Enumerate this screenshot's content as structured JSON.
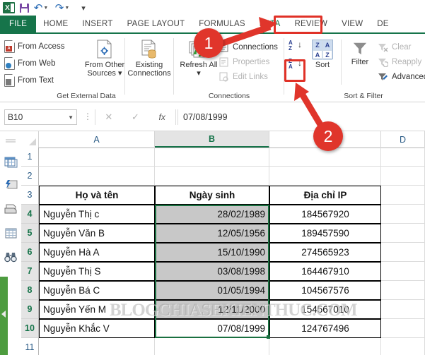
{
  "app": {
    "quick_access": [
      {
        "name": "excel-logo",
        "label": "X"
      },
      {
        "name": "save",
        "label": "Save"
      },
      {
        "name": "undo",
        "label": "Undo"
      },
      {
        "name": "redo",
        "label": "Redo"
      },
      {
        "name": "customize-quick-access-toolbar",
        "label": "Customize Quick Access Toolbar"
      }
    ]
  },
  "ribbon": {
    "tabs": [
      {
        "label": "FILE",
        "active": false,
        "style": "file"
      },
      {
        "label": "HOME",
        "active": false
      },
      {
        "label": "INSERT",
        "active": false
      },
      {
        "label": "PAGE LAYOUT",
        "active": false
      },
      {
        "label": "FORMULAS",
        "active": false
      },
      {
        "label": "DATA",
        "active": true
      },
      {
        "label": "REVIEW",
        "active": false
      },
      {
        "label": "VIEW",
        "active": false
      },
      {
        "label": "DE",
        "active": false
      }
    ],
    "groups": [
      {
        "name": "get-external-data",
        "title": "Get External Data",
        "items": [
          {
            "label": "From Access",
            "icon": "access-file-icon",
            "enabled": true
          },
          {
            "label": "From Web",
            "icon": "web-file-icon",
            "enabled": true
          },
          {
            "label": "From Text",
            "icon": "text-file-icon",
            "enabled": true
          },
          {
            "label": "From Other Sources",
            "icon": "other-sources-icon",
            "enabled": true,
            "dropdown": "▾"
          },
          {
            "label": "Existing Connections",
            "icon": "existing-connections-icon",
            "enabled": true
          }
        ]
      },
      {
        "name": "connections",
        "title": "Connections",
        "items": [
          {
            "label": "Refresh All",
            "icon": "refresh-all-icon",
            "enabled": true,
            "dropdown": "▾"
          },
          {
            "label": "Connections",
            "icon": "connections-icon",
            "enabled": true
          },
          {
            "label": "Properties",
            "icon": "properties-icon",
            "enabled": false
          },
          {
            "label": "Edit Links",
            "icon": "edit-links-icon",
            "enabled": false
          }
        ]
      },
      {
        "name": "sort-and-filter",
        "title": "Sort & Filter",
        "items": [
          {
            "label": "Sort A to Z",
            "icon": "sort-ascending-icon",
            "enabled": true,
            "top": "A",
            "bottom": "Z"
          },
          {
            "label": "Sort Z to A",
            "icon": "sort-descending-icon",
            "enabled": true,
            "top": "Z",
            "bottom": "A",
            "highlighted": true
          },
          {
            "label": "Sort",
            "icon": "sort-dialog-icon",
            "enabled": true
          },
          {
            "label": "Filter",
            "icon": "filter-funnel-icon",
            "enabled": true
          },
          {
            "label": "Clear",
            "icon": "clear-filter-icon",
            "enabled": false
          },
          {
            "label": "Reapply",
            "icon": "reapply-filter-icon",
            "enabled": false
          },
          {
            "label": "Advanced",
            "icon": "advanced-filter-icon",
            "enabled": true
          }
        ]
      }
    ]
  },
  "formula_bar": {
    "name_box": "B10",
    "cancel_icon": "✕",
    "enter_icon": "✓",
    "function_icon": "fx",
    "value": "07/08/1999"
  },
  "left_toolbar": {
    "items": [
      {
        "name": "divider",
        "icon": "divider-icon"
      },
      {
        "name": "table-tool",
        "icon": "table-icon"
      },
      {
        "name": "flash-fill-tool",
        "icon": "flash-fill-icon"
      },
      {
        "name": "print-tool",
        "icon": "printer-icon"
      },
      {
        "name": "sheet-tool",
        "icon": "sheet-grid-icon"
      },
      {
        "name": "find-tool",
        "icon": "binoculars-icon"
      }
    ]
  },
  "sheet": {
    "columns": [
      "A",
      "B",
      "C",
      "D"
    ],
    "selected_column": "B",
    "rows": [
      "1",
      "2",
      "3",
      "4",
      "5",
      "6",
      "7",
      "8",
      "9",
      "10",
      "11"
    ],
    "selected_rows": [
      "4",
      "5",
      "6",
      "7",
      "8",
      "9",
      "10"
    ],
    "headers": [
      "Họ và tên",
      "Ngày sinh",
      "Địa chỉ IP"
    ],
    "data": [
      {
        "row": "4",
        "name": "Nguyễn Thị c",
        "dob": "28/02/1989",
        "ip": "184567920",
        "shaded": true
      },
      {
        "row": "5",
        "name": "Nguyễn Văn B",
        "dob": "12/05/1956",
        "ip": "189457590",
        "shaded": true
      },
      {
        "row": "6",
        "name": "Nguyễn Hà A",
        "dob": "15/10/1990",
        "ip": "274565923",
        "shaded": true
      },
      {
        "row": "7",
        "name": "Nguyễn Thị S",
        "dob": "03/08/1998",
        "ip": "164467910",
        "shaded": true
      },
      {
        "row": "8",
        "name": "Nguyễn Bá C",
        "dob": "01/05/1994",
        "ip": "104567576",
        "shaded": true
      },
      {
        "row": "9",
        "name": "Nguyễn Yến M",
        "dob": "12/11/2000",
        "ip": "154567010",
        "shaded": true
      },
      {
        "row": "10",
        "name": "Nguyễn Khắc V",
        "dob": "07/08/1999",
        "ip": "124767496",
        "shaded": false
      }
    ],
    "watermark": "BLOGCHIASEKIENTHUC.COM"
  },
  "annotations": {
    "step1": {
      "label": "1",
      "points_to": "DATA tab"
    },
    "step2": {
      "label": "2",
      "points_to": "Sort Z to A button"
    },
    "accent_red": "#e0352b",
    "accent_green": "#16744a"
  }
}
